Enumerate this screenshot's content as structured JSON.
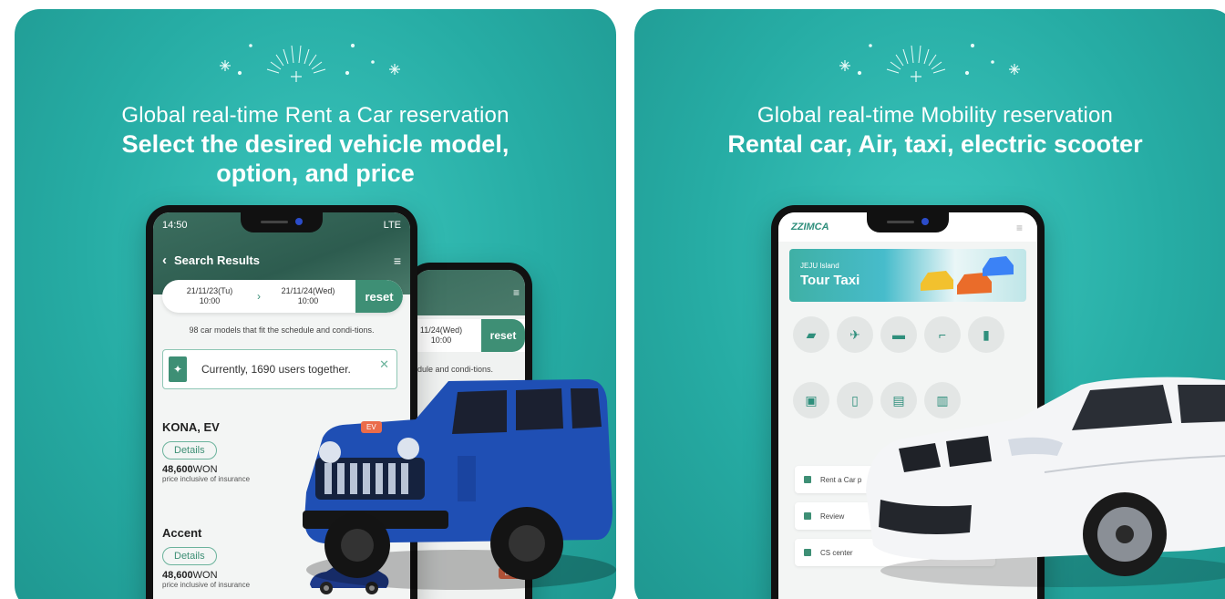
{
  "left_panel": {
    "subtitle": "Global real-time Rent a Car reservation",
    "title_line1": "Select the desired vehicle model,",
    "title_line2": "option, and price",
    "status_time": "14:50",
    "status_signal": "LTE",
    "nav_title": "Search Results",
    "date_from": "21/11/23(Tu)",
    "time_from": "10:00",
    "date_to": "21/11/24(Wed)",
    "time_to": "10:00",
    "reset_label": "reset",
    "count_text": "98 car models that fit the schedule and condi-tions.",
    "users_text": "Currently, 1690 users together.",
    "cars": [
      {
        "name": "KONA, EV",
        "details_label": "Details",
        "price_value": "48,600",
        "price_unit": "WON",
        "price_note": "price inclusive of insurance"
      },
      {
        "name": "Accent",
        "details_label": "Details",
        "price_value": "48,600",
        "price_unit": "WON",
        "price_note": "price inclusive of insurance"
      }
    ],
    "back_phone": {
      "date_to": "11/24(Wed)",
      "time_to": "10:00",
      "reset_label": "reset",
      "count_text": "dule and condi-tions.",
      "ev_tag": "EV"
    }
  },
  "right_panel": {
    "subtitle": "Global real-time Mobility reservation",
    "title": "Rental car, Air, taxi, electric scooter",
    "logo_text": "ZZIMCA",
    "banner_small": "JEJU Island",
    "banner_large": "Tour Taxi",
    "menu_items": [
      "Rent a Car p",
      "Review",
      "CS center"
    ]
  },
  "colors": {
    "panel_bg": "#26aca4",
    "accent_green": "#3e8f75",
    "ev_orange": "#ea6c4a"
  }
}
